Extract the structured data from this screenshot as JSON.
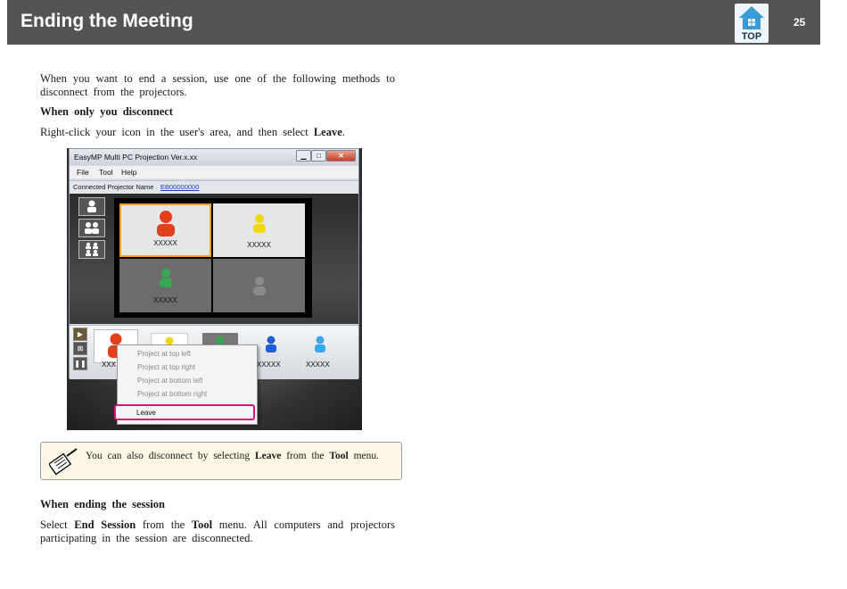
{
  "header": {
    "title": "Ending the Meeting",
    "top_label": "TOP",
    "page_number": "25",
    "accent": "#545454"
  },
  "body": {
    "intro_line1": "When you want to end a session, use one of the following methods to",
    "intro_line2": "disconnect from the projectors.",
    "heading_disconnect": "When only you disconnect",
    "instruction_prefix": "Right-click your icon in the user's area, and then select ",
    "instruction_bold": "Leave",
    "instruction_suffix": ".",
    "heading_end": "When ending the session",
    "end_parts": {
      "p1": "Select ",
      "b1": "End Session",
      "p2": " from the ",
      "b2": "Tool",
      "p3": " menu. All computers and projectors"
    },
    "end_line2": "participating in the session are disconnected."
  },
  "screenshot": {
    "window_title": "EasyMP Multi PC Projection Ver.x.xx",
    "menu": [
      "File",
      "Tool",
      "Help"
    ],
    "connected_label": "Connected Projector Name",
    "projector_name": "EB00000000",
    "cells": [
      {
        "name": "XXXXX",
        "color": "#e0401b"
      },
      {
        "name": "XXXXX",
        "color": "#f0d818"
      },
      {
        "name": "XXXXX",
        "color": "#34a853"
      },
      {
        "name": "",
        "color": "#8a8a8a"
      }
    ],
    "tray_users": [
      {
        "name": "XXX",
        "color": "#e0401b"
      },
      {
        "name": "",
        "color": "#f0d818"
      },
      {
        "name": "",
        "color": "#34a853"
      },
      {
        "name": "XXXXX",
        "color": "#1f5fd6"
      },
      {
        "name": "XXXXX",
        "color": "#3aa8e6"
      }
    ],
    "context_menu": [
      "Project at top left",
      "Project at top right",
      "Project at bottom left",
      "Project at bottom right"
    ],
    "context_leave": "Leave"
  },
  "note": {
    "icon": "note-pencil-icon",
    "parts": {
      "p1": "You can also disconnect by selecting ",
      "b1": "Leave",
      "p2": " from the ",
      "b2": "Tool",
      "p3": " menu."
    }
  }
}
